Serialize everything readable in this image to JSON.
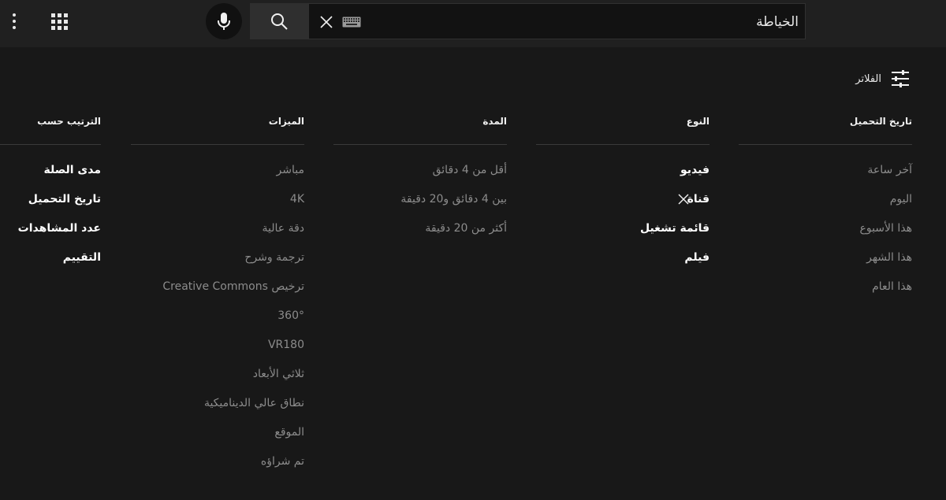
{
  "topbar": {
    "menu_icon": "more-vert-icon",
    "apps_icon": "apps-grid-icon",
    "mic_icon": "microphone-icon",
    "search_icon": "search-icon",
    "clear_icon": "close-icon",
    "keyboard_icon": "keyboard-icon",
    "search_value": "الخياطة"
  },
  "filters": {
    "label": "الفلاتر",
    "icon": "tune-icon"
  },
  "columns": [
    {
      "header": "تاريخ التحميل",
      "options": [
        {
          "label": "آخر ساعة",
          "active": false
        },
        {
          "label": "اليوم",
          "active": false
        },
        {
          "label": "هذا الأسبوع",
          "active": false
        },
        {
          "label": "هذا الشهر",
          "active": false
        },
        {
          "label": "هذا العام",
          "active": false
        }
      ]
    },
    {
      "header": "النوع",
      "options": [
        {
          "label": "فيديو",
          "active": true
        },
        {
          "label": "قناة",
          "active": true,
          "removable": true
        },
        {
          "label": "قائمة تشغيل",
          "active": true
        },
        {
          "label": "فيلم",
          "active": true
        }
      ]
    },
    {
      "header": "المدة",
      "options": [
        {
          "label": "أقل من 4 دقائق",
          "active": false
        },
        {
          "label": "بين 4 دقائق و20 دقيقة",
          "active": false
        },
        {
          "label": "أكثر من 20 دقيقة",
          "active": false
        }
      ]
    },
    {
      "header": "الميزات",
      "options": [
        {
          "label": "مباشر",
          "active": false
        },
        {
          "label": "4K",
          "active": false
        },
        {
          "label": "دقة عالية",
          "active": false
        },
        {
          "label": "ترجمة وشرح",
          "active": false
        },
        {
          "label": "ترخيص Creative Commons",
          "active": false
        },
        {
          "label": "360°",
          "active": false
        },
        {
          "label": "VR180",
          "active": false
        },
        {
          "label": "ثلاثي الأبعاد",
          "active": false
        },
        {
          "label": "نطاق عالي الديناميكية",
          "active": false
        },
        {
          "label": "الموقع",
          "active": false
        },
        {
          "label": "تم شراؤه",
          "active": false
        }
      ]
    },
    {
      "header": "الترتيب حسب",
      "options": [
        {
          "label": "مدى الصلة",
          "active": true
        },
        {
          "label": "تاريخ التحميل",
          "active": true
        },
        {
          "label": "عدد المشاهدات",
          "active": true
        },
        {
          "label": "التقييم",
          "active": true
        }
      ]
    }
  ]
}
